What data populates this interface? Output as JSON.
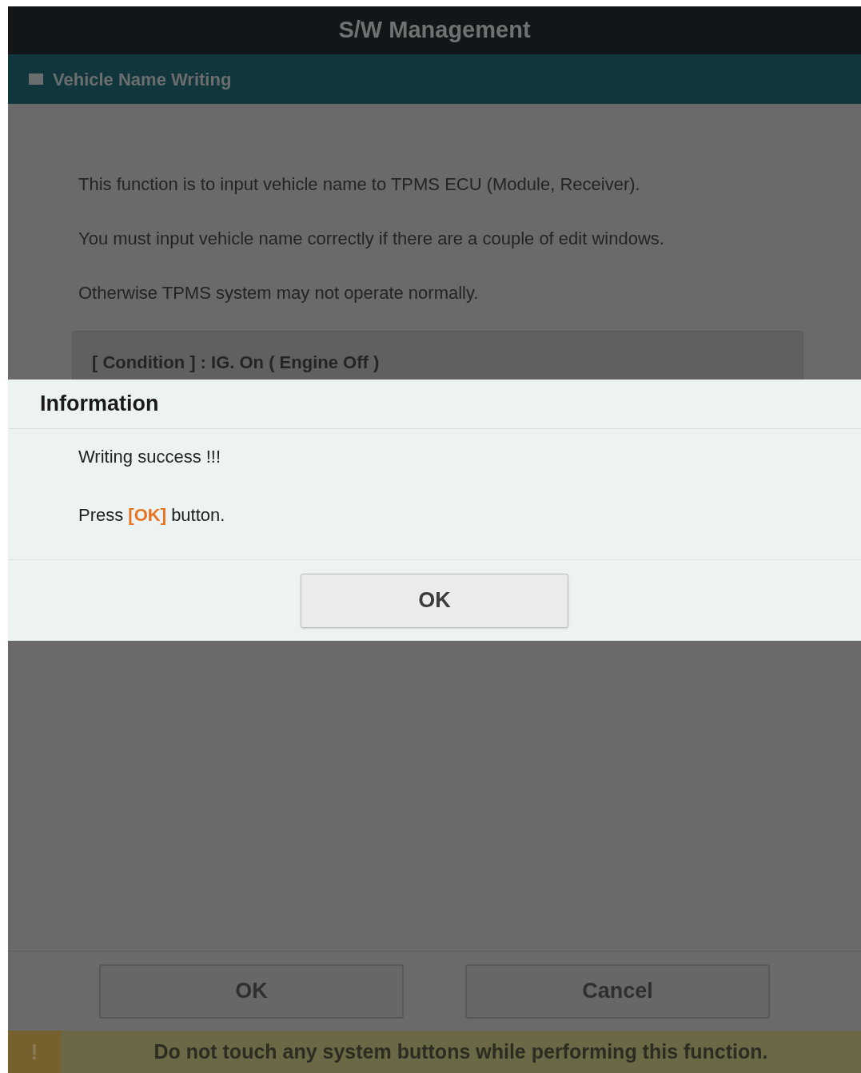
{
  "window": {
    "title": "S/W Management"
  },
  "section": {
    "title": "Vehicle Name Writing"
  },
  "description": [
    "This function is to input vehicle name to TPMS ECU (Module, Receiver).",
    "You must input vehicle name correctly if there are a couple of edit windows.",
    "Otherwise TPMS system may not operate normally."
  ],
  "condition": {
    "text": "[ Condition ] : IG. On ( Engine Off )"
  },
  "dialog": {
    "title": "Information",
    "messages": [
      "Writing success !!!",
      "Press **[OK]** button."
    ],
    "button": "OK"
  },
  "buttons": [
    "OK",
    "Cancel"
  ],
  "warning": {
    "icon": "!",
    "text": "Do not touch any system buttons while performing this function."
  }
}
